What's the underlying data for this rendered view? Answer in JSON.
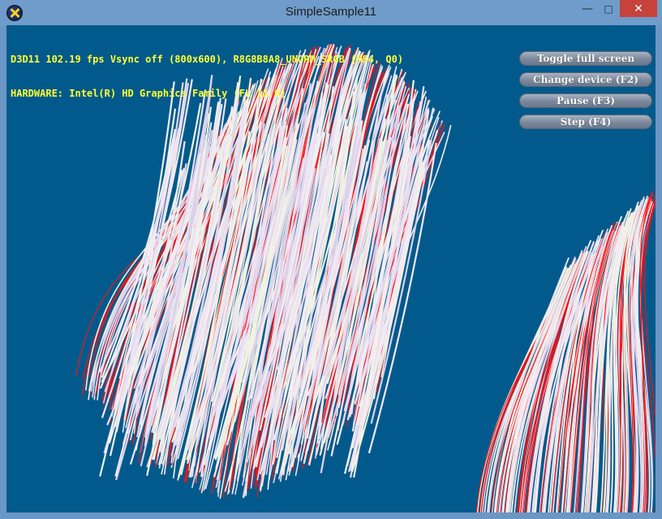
{
  "window": {
    "title": "SimpleSample11",
    "icon": "directx-app-icon",
    "controls": {
      "minimize": "—",
      "maximize": "□",
      "close": "✕"
    }
  },
  "stats": {
    "line1": "D3D11 102.19 fps Vsync off (800x600), R8G8B8A8_UNORM_SRGB (MS4, Q0)",
    "line2": "HARDWARE: Intel(R) HD Graphics Family (FL 11.0)"
  },
  "hud": {
    "buttons": [
      {
        "label": "Toggle full screen"
      },
      {
        "label": "Change device (F2)"
      },
      {
        "label": "Pause (F3)"
      },
      {
        "label": "Step (F4)"
      }
    ]
  },
  "colors": {
    "background": "#025a8c",
    "hair_base": "#ecdeef",
    "hair_red": "#ff0000",
    "text_yellow": "#ffff33"
  }
}
